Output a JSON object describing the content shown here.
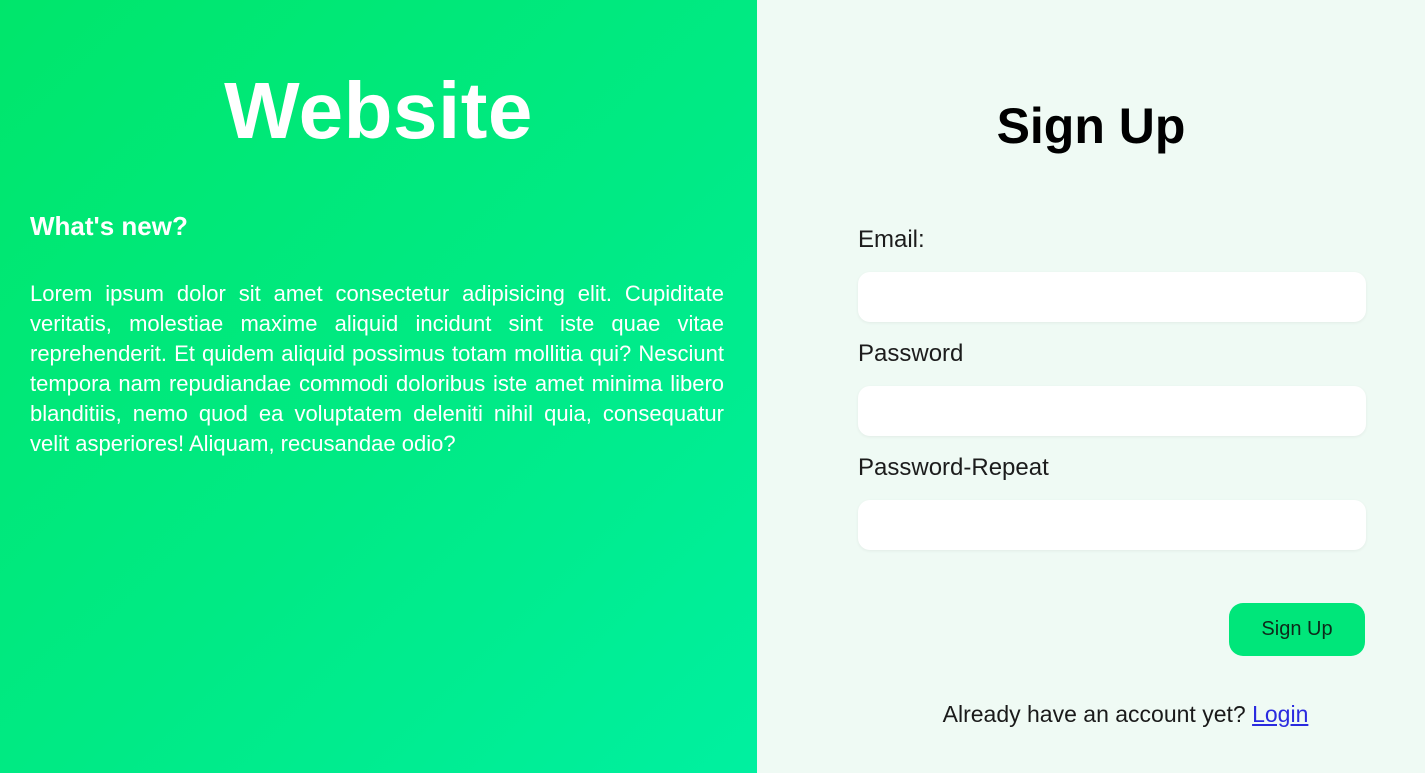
{
  "left_panel": {
    "title": "Website",
    "news_heading": "What's new?",
    "news_body": "Lorem ipsum dolor sit amet consectetur adipisicing elit. Cupiditate veritatis, molestiae maxime aliquid incidunt sint iste quae vitae reprehenderit. Et quidem aliquid possimus totam mollitia qui? Nesciunt tempora nam repudiandae commodi doloribus iste amet minima libero blanditiis, nemo quod ea voluptatem deleniti nihil quia, consequatur velit asperiores! Aliquam, recusandae odio?"
  },
  "signup_form": {
    "title": "Sign Up",
    "email_label": "Email:",
    "email_value": "",
    "password_label": "Password",
    "password_value": "",
    "password_repeat_label": "Password-Repeat",
    "password_repeat_value": "",
    "submit_label": "Sign Up",
    "login_prompt": "Already have an account yet?",
    "login_link": "Login"
  },
  "colors": {
    "left_gradient_start": "#00e66b",
    "left_gradient_end": "#00f0a0",
    "right_background": "#effaf4",
    "button_background": "#00e67a",
    "link_color": "#2a2adf"
  }
}
